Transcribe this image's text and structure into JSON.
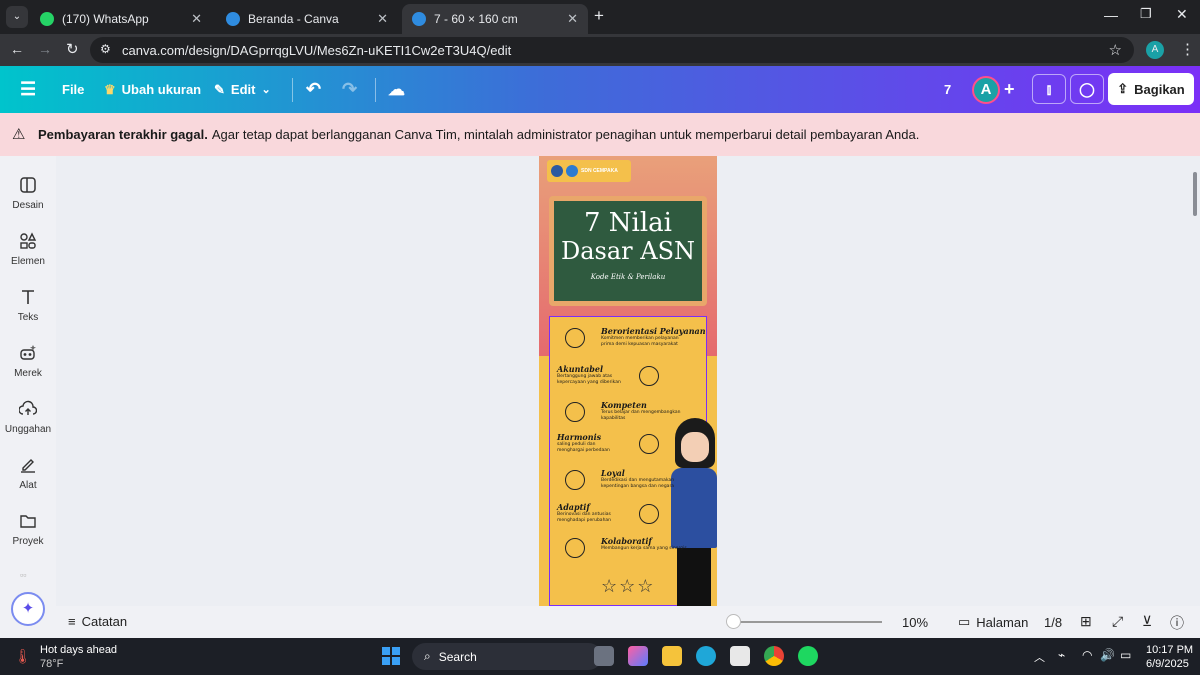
{
  "browser": {
    "tabs": [
      {
        "title": "(170) WhatsApp"
      },
      {
        "title": "Beranda - Canva"
      },
      {
        "title": "7 - 60 × 160 cm"
      }
    ],
    "url": "canva.com/design/DAGprrqgLVU/Mes6Zn-uKETI1Cw2eT3U4Q/edit",
    "profile_letter": "A"
  },
  "canva": {
    "menu": {
      "file": "File",
      "resize": "Ubah ukuran",
      "edit": "Edit"
    },
    "page_count_badge": "7",
    "avatar_letter": "A",
    "share": "Bagikan",
    "alert_bold": "Pembayaran terakhir gagal.",
    "alert_text": "Agar tetap dapat berlangganan Canva Tim, mintalah administrator penagihan untuk memperbarui detail pembayaran Anda.",
    "sidebar": [
      {
        "label": "Desain",
        "icon": "layout-icon"
      },
      {
        "label": "Elemen",
        "icon": "shapes-icon"
      },
      {
        "label": "Teks",
        "icon": "text-icon"
      },
      {
        "label": "Merek",
        "icon": "brand-icon"
      },
      {
        "label": "Unggahan",
        "icon": "upload-icon"
      },
      {
        "label": "Alat",
        "icon": "draw-icon"
      },
      {
        "label": "Proyek",
        "icon": "folder-icon"
      }
    ],
    "bottom": {
      "notes": "Catatan",
      "zoom": "10%",
      "pages": "Halaman",
      "page_indicator": "1/8"
    }
  },
  "poster": {
    "badge": "SDN CEMPAKA",
    "title_line1": "7 Nilai",
    "title_line2": "Dasar ASN",
    "subtitle": "Kode Etik & Perilaku",
    "values": [
      {
        "name": "Berorientasi Pelayanan",
        "desc": "Komitmen memberikan pelayanan prima demi kepuasan masyarakat"
      },
      {
        "name": "Akuntabel",
        "desc": "Bertanggung jawab atas kepercayaan yang diberikan"
      },
      {
        "name": "Kompeten",
        "desc": "Terus belajar dan mengembangkan kapabilitas"
      },
      {
        "name": "Harmonis",
        "desc": "saling peduli dan menghargai perbedaan"
      },
      {
        "name": "Loyal",
        "desc": "Berdedikasi dan mengutamakan kepentingan bangsa dan negara"
      },
      {
        "name": "Adaptif",
        "desc": "Berinovasi dan antusias menghadapi perubahan"
      },
      {
        "name": "Kolaboratif",
        "desc": "Membangun kerja sama yang sinergis"
      }
    ]
  },
  "taskbar": {
    "weather_title": "Hot days ahead",
    "weather_temp": "78°F",
    "search": "Search",
    "time": "10:17 PM",
    "date": "6/9/2025"
  },
  "colors": {
    "accent": "#7b2ff7",
    "teal": "#00c4cc",
    "alert_bg": "#f9d8dc",
    "poster_yellow": "#f4c04b",
    "chalkboard": "#2f5a3f"
  }
}
